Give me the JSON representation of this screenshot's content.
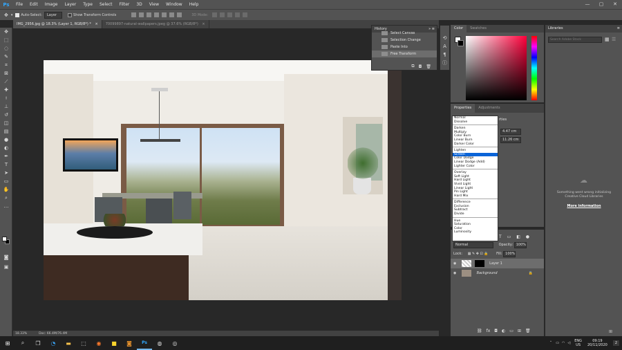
{
  "app": {
    "logo": "Ps"
  },
  "menu": [
    "File",
    "Edit",
    "Image",
    "Layer",
    "Type",
    "Select",
    "Filter",
    "3D",
    "View",
    "Window",
    "Help"
  ],
  "window_controls": {
    "minimize": "—",
    "maximize": "▢",
    "close": "✕"
  },
  "options": {
    "auto_select_label": "Auto-Select:",
    "auto_select_value": "Layer",
    "transform_label": "Show Transform Controls",
    "mode_label": "3D Mode:"
  },
  "doc_tabs": [
    {
      "label": "IMG_2956.jpg @ 18.3% (Layer 1, RGB/8*) *",
      "close": "×"
    },
    {
      "label": "70099897-natural-wallpapers.jpeg @ 37.6% (RGB/8*)",
      "close": "×"
    }
  ],
  "status": {
    "zoom": "18.33%",
    "doc": "Doc: 66.4M/76.4M"
  },
  "history": {
    "title": "History",
    "items": [
      "Select Canvas",
      "Selection Change",
      "Paste Into",
      "Free Transform"
    ],
    "active_index": 3
  },
  "color_panel": {
    "tabs": [
      "Color",
      "Swatches"
    ],
    "fg": "#ffffff",
    "bg": "#000000"
  },
  "properties": {
    "tabs": [
      "Properties",
      "Adjustments"
    ],
    "header": "rties",
    "w": "4.47 cm",
    "h": "11.26 cm"
  },
  "blend_modes": {
    "groups": [
      [
        "Normal",
        "Dissolve"
      ],
      [
        "Darken",
        "Multiply",
        "Color Burn",
        "Linear Burn",
        "Darker Color"
      ],
      [
        "Lighten",
        "Screen",
        "Color Dodge",
        "Linear Dodge (Add)",
        "Lighter Color"
      ],
      [
        "Overlay",
        "Soft Light",
        "Hard Light",
        "Vivid Light",
        "Linear Light",
        "Pin Light",
        "Hard Mix"
      ],
      [
        "Difference",
        "Exclusion",
        "Subtract",
        "Divide"
      ],
      [
        "Hue",
        "Saturation",
        "Color",
        "Luminosity"
      ]
    ],
    "selected": "Screen"
  },
  "layers": {
    "blend_value": "Normal",
    "opacity_label": "Opacity:",
    "opacity_value": "100%",
    "lock_label": "Lock:",
    "fill_label": "Fill:",
    "fill_value": "100%",
    "items": [
      {
        "name": "Layer 1",
        "selected": true
      },
      {
        "name": "Background",
        "selected": false
      }
    ],
    "footer_icons": [
      "link",
      "fx",
      "mask",
      "adjust",
      "folder",
      "new",
      "trash"
    ]
  },
  "libraries": {
    "title": "Libraries",
    "search_placeholder": "Search Adobe Stock",
    "message": "Something went wrong initializing Creative Cloud Libraries",
    "link": "More information"
  },
  "taskbar": {
    "lang": "ENG",
    "region": "US",
    "time": "09:19",
    "date": "20/11/2020",
    "notify": "2"
  }
}
